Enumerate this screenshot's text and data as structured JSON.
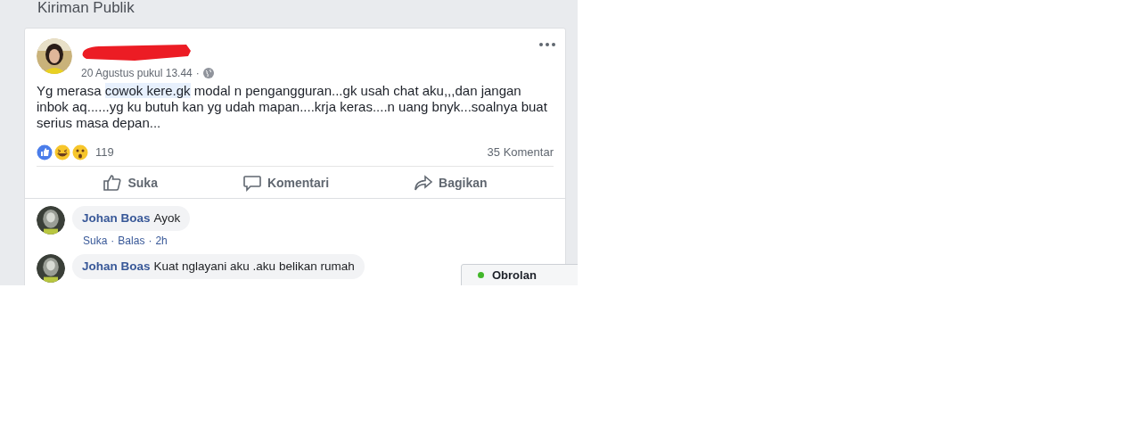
{
  "section_title": "Kiriman Publik",
  "post": {
    "timestamp": "20 Agustus pukul 13.44",
    "separator": "·",
    "text": [
      {
        "text": "Yg merasa ",
        "highlighted": false
      },
      {
        "text": "cowok kere.gk",
        "highlighted": true
      },
      {
        "text": " modal n pengangguran...gk usah chat aku,,,dan jangan inbok aq......yg ku butuh kan yg udah mapan....krja keras....n uang bnyk...soalnya buat serius masa depan...",
        "highlighted": false
      }
    ],
    "reaction_count": "119",
    "comment_count": "35 Komentar",
    "actions": [
      {
        "kind": "like",
        "label": "Suka"
      },
      {
        "kind": "comment",
        "label": "Komentari"
      },
      {
        "kind": "share",
        "label": "Bagikan"
      }
    ]
  },
  "comments": [
    {
      "author": "Johan Boas",
      "text": "Ayok",
      "meta": [
        "Suka",
        "Balas",
        "2h"
      ],
      "meta_separator": "·"
    },
    {
      "author": "Johan Boas",
      "text": "Kuat nglayani aku .aku belikan rumah"
    }
  ],
  "chat": {
    "label": "Obrolan",
    "online": true
  }
}
